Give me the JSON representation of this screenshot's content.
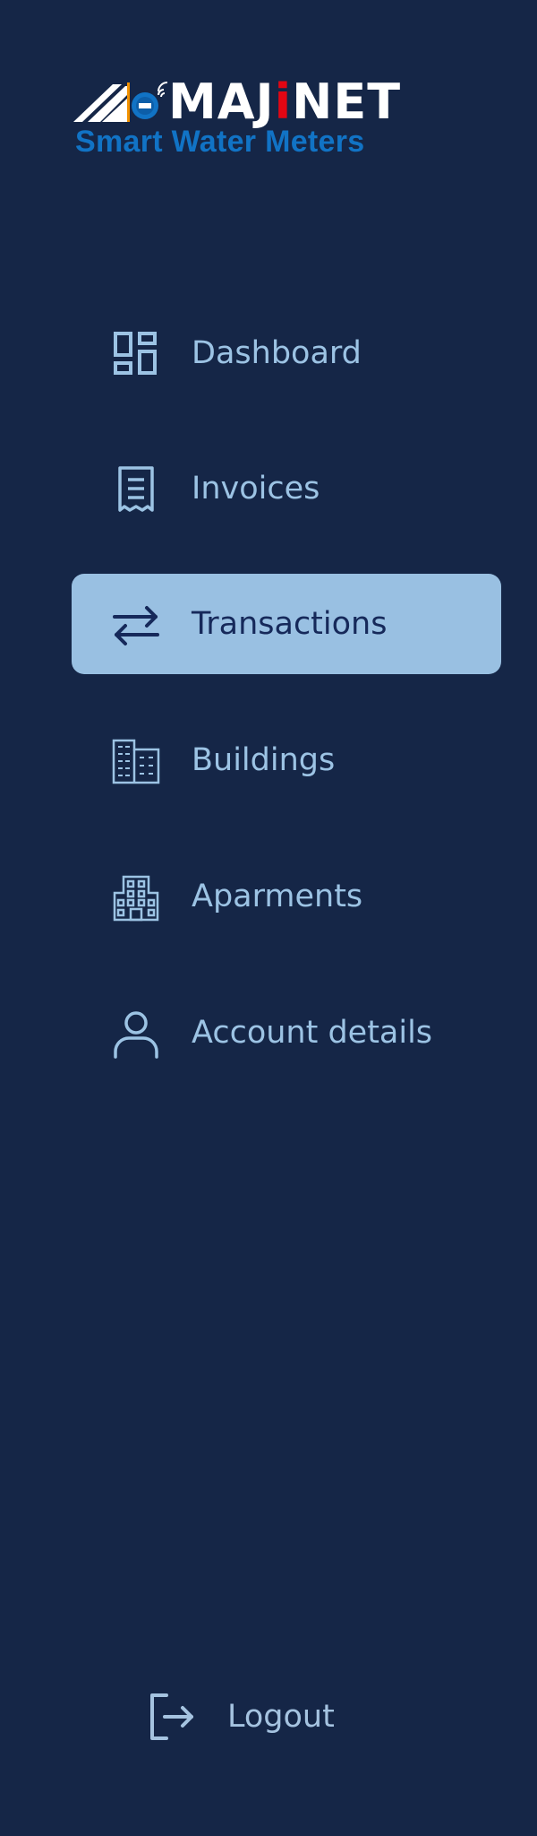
{
  "brand": {
    "name_part1": "MAJ",
    "name_accent": "i",
    "name_part2": "NET",
    "tagline": "Smart Water Meters",
    "colors": {
      "background": "#152647",
      "accent_red": "#e30613",
      "tagline_blue": "#1173c5",
      "meter_orange": "#f39200"
    }
  },
  "nav": {
    "items": [
      {
        "label": "Dashboard",
        "icon": "dashboard-icon",
        "active": false
      },
      {
        "label": "Invoices",
        "icon": "receipt-icon",
        "active": false
      },
      {
        "label": "Transactions",
        "icon": "arrows-exchange-icon",
        "active": true
      },
      {
        "label": "Buildings",
        "icon": "building-icon",
        "active": false
      },
      {
        "label": "Aparments",
        "icon": "apartment-icon",
        "active": false
      },
      {
        "label": "Account details",
        "icon": "user-icon",
        "active": false
      }
    ],
    "colors": {
      "item_text": "#9cc3e4",
      "active_bg": "#99c0e2",
      "active_text": "#16295a"
    }
  },
  "footer": {
    "logout_label": "Logout",
    "logout_icon": "logout-icon"
  }
}
